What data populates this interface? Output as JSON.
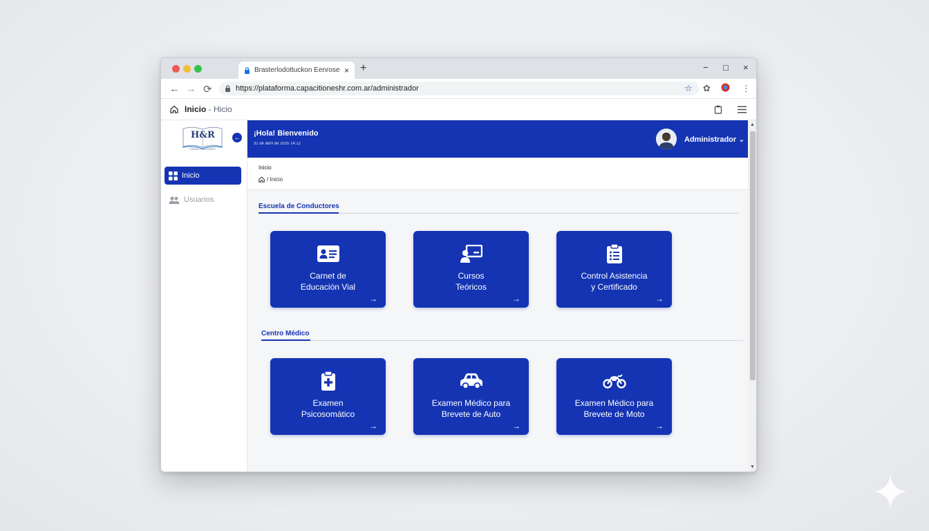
{
  "browser": {
    "tab_title": "Brasterlodottuckon Eenroses",
    "tab_close": "×",
    "new_tab": "+",
    "url": "https://plataforma.capacitioneshr.com.ar/administrador",
    "window_controls": {
      "minimize": "−",
      "maximize": "□",
      "close": "×"
    }
  },
  "app_header": {
    "title": "Inicio",
    "subtitle": " - Hicio"
  },
  "sidebar": {
    "logo_text": "H&R",
    "logo_caption": "CAPACITACIONES",
    "items": [
      {
        "label": "Inicio",
        "icon": "grid-icon",
        "active": true
      },
      {
        "label": "Usuarios",
        "icon": "users-icon",
        "active": false
      }
    ]
  },
  "banner": {
    "greeting": "¡Hola! Bienvenido",
    "date": "31 de abril de 2025 14:12",
    "user": "Administrador ⌄"
  },
  "breadcrumb": {
    "title": "Inicio",
    "path": "/ Inicio"
  },
  "sections": [
    {
      "title": "Escuela de Conductores",
      "cards": [
        {
          "label_line1": "Carnet de",
          "label_line2": "Educación Vial",
          "icon": "id-card-icon"
        },
        {
          "label_line1": "Cursos",
          "label_line2": "Teóricos",
          "icon": "presentation-icon"
        },
        {
          "label_line1": "Control Asistencia",
          "label_line2": "y Certificado",
          "icon": "clipboard-list-icon"
        }
      ]
    },
    {
      "title": "Centro Médico",
      "cards": [
        {
          "label_line1": "Examen",
          "label_line2": "Psicosomático",
          "icon": "medical-clipboard-icon"
        },
        {
          "label_line1": "Examen Médico para",
          "label_line2": "Brevete de Auto",
          "icon": "car-icon"
        },
        {
          "label_line1": "Examen Médico para",
          "label_line2": "Brevete de Moto",
          "icon": "motorcycle-icon"
        }
      ]
    }
  ],
  "card_arrow": "→",
  "colors": {
    "primary": "#1434b3",
    "background": "#f5f6f8",
    "sidebar_inactive": "#9aa0a8"
  }
}
